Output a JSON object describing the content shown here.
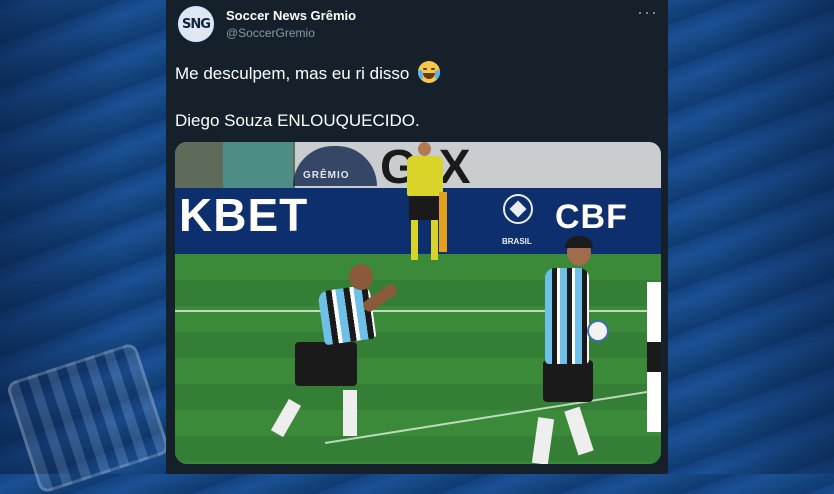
{
  "tweet": {
    "avatar_text": "SNG",
    "display_name": "Soccer News Grêmio",
    "handle": "@SoccerGremio",
    "more_label": "···",
    "line1": "Me desculpem, mas eu ri disso",
    "line2": "Diego Souza ENLOUQUECIDO."
  },
  "photo": {
    "crest_text": "GRÊMIO",
    "big_letters": "G X",
    "adboard_logo": "KBET",
    "adboard_sub": "BRASIL",
    "adboard_cbf": "CBF"
  },
  "colors": {
    "page_background": "#1b5096",
    "card_background": "#15202b",
    "secondary_text": "#8899a6",
    "pitch": "#3a8a3a"
  },
  "icons": {
    "emoji": "face-with-tears-of-joy",
    "more": "more-horizontal-icon"
  }
}
